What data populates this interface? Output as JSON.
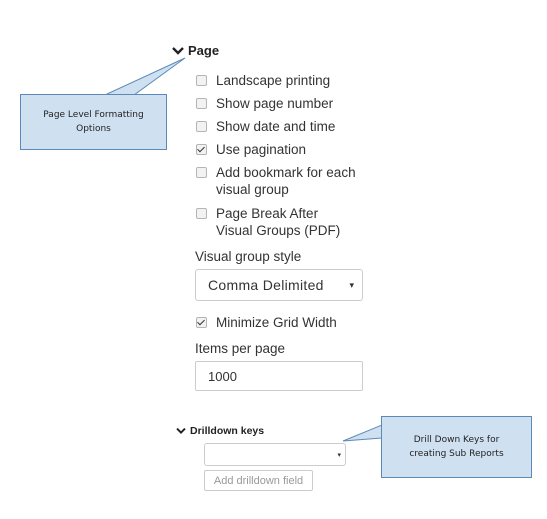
{
  "page_section": {
    "title": "Page",
    "options": [
      {
        "label": "Landscape printing",
        "checked": false
      },
      {
        "label": "Show page number",
        "checked": false
      },
      {
        "label": "Show date and time",
        "checked": false
      },
      {
        "label": "Use pagination",
        "checked": true
      },
      {
        "label": "Add bookmark for each visual group",
        "checked": false
      },
      {
        "label": "Page Break After Visual Groups (PDF)",
        "checked": false
      }
    ],
    "visual_group_style": {
      "label": "Visual group style",
      "selected": "Comma Delimited"
    },
    "minimize_grid_width": {
      "label": "Minimize Grid Width",
      "checked": true
    },
    "items_per_page": {
      "label": "Items per page",
      "value": "1000"
    }
  },
  "drilldown_section": {
    "title": "Drilldown keys",
    "selected": "",
    "add_button": "Add drilldown field"
  },
  "callouts": {
    "page_level": "Page Level Formatting Options",
    "drill_down": "Drill Down Keys for creating Sub Reports"
  },
  "colors": {
    "callout_fill": "#cfe0f1",
    "callout_border": "#5b8ab8"
  }
}
